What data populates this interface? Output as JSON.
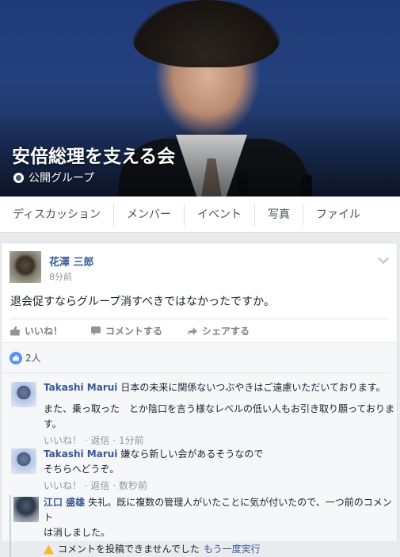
{
  "group": {
    "title": "安倍総理を支える会",
    "type_label": "公開グループ"
  },
  "tabs": [
    "ディスカッション",
    "メンバー",
    "イベント",
    "写真",
    "ファイル"
  ],
  "post": {
    "author": "花澤 三郎",
    "time": "8分前",
    "text": "退会促すならグループ消すべきではなかったですか。",
    "actions": {
      "like": "いいね！",
      "comment": "コメントする",
      "share": "シェアする"
    },
    "like_count": "2人"
  },
  "comments": [
    {
      "author": "Takashi Marui",
      "text_lines": [
        "日本の未来に関係ないつぶやきはご遠慮いただいております。",
        "",
        "また、乗っ取った　とか陰口を言う様なレベルの低い人もお引き取り願っております。"
      ],
      "like": "いいね！",
      "reply": "返信",
      "time": "1分前"
    },
    {
      "author": "Takashi Marui",
      "text_lines": [
        "嫌なら新しい会があるそうなので",
        "そちらへどうぞ。"
      ],
      "like": "いいね！",
      "reply": "返信",
      "time": "数秒前"
    },
    {
      "author": "江口 盛雄",
      "text_lines": [
        "失礼。既に複数の管理人がいたことに気が付いたので、一つ前のコメント",
        "は消しました。"
      ],
      "error": "コメントを投稿できませんでした",
      "retry": "もう一度実行"
    }
  ],
  "separator": "·",
  "colors": {
    "link": "#365899",
    "muted": "#90949c",
    "like_blue": "#5890ff",
    "warning": "#f7b928"
  }
}
